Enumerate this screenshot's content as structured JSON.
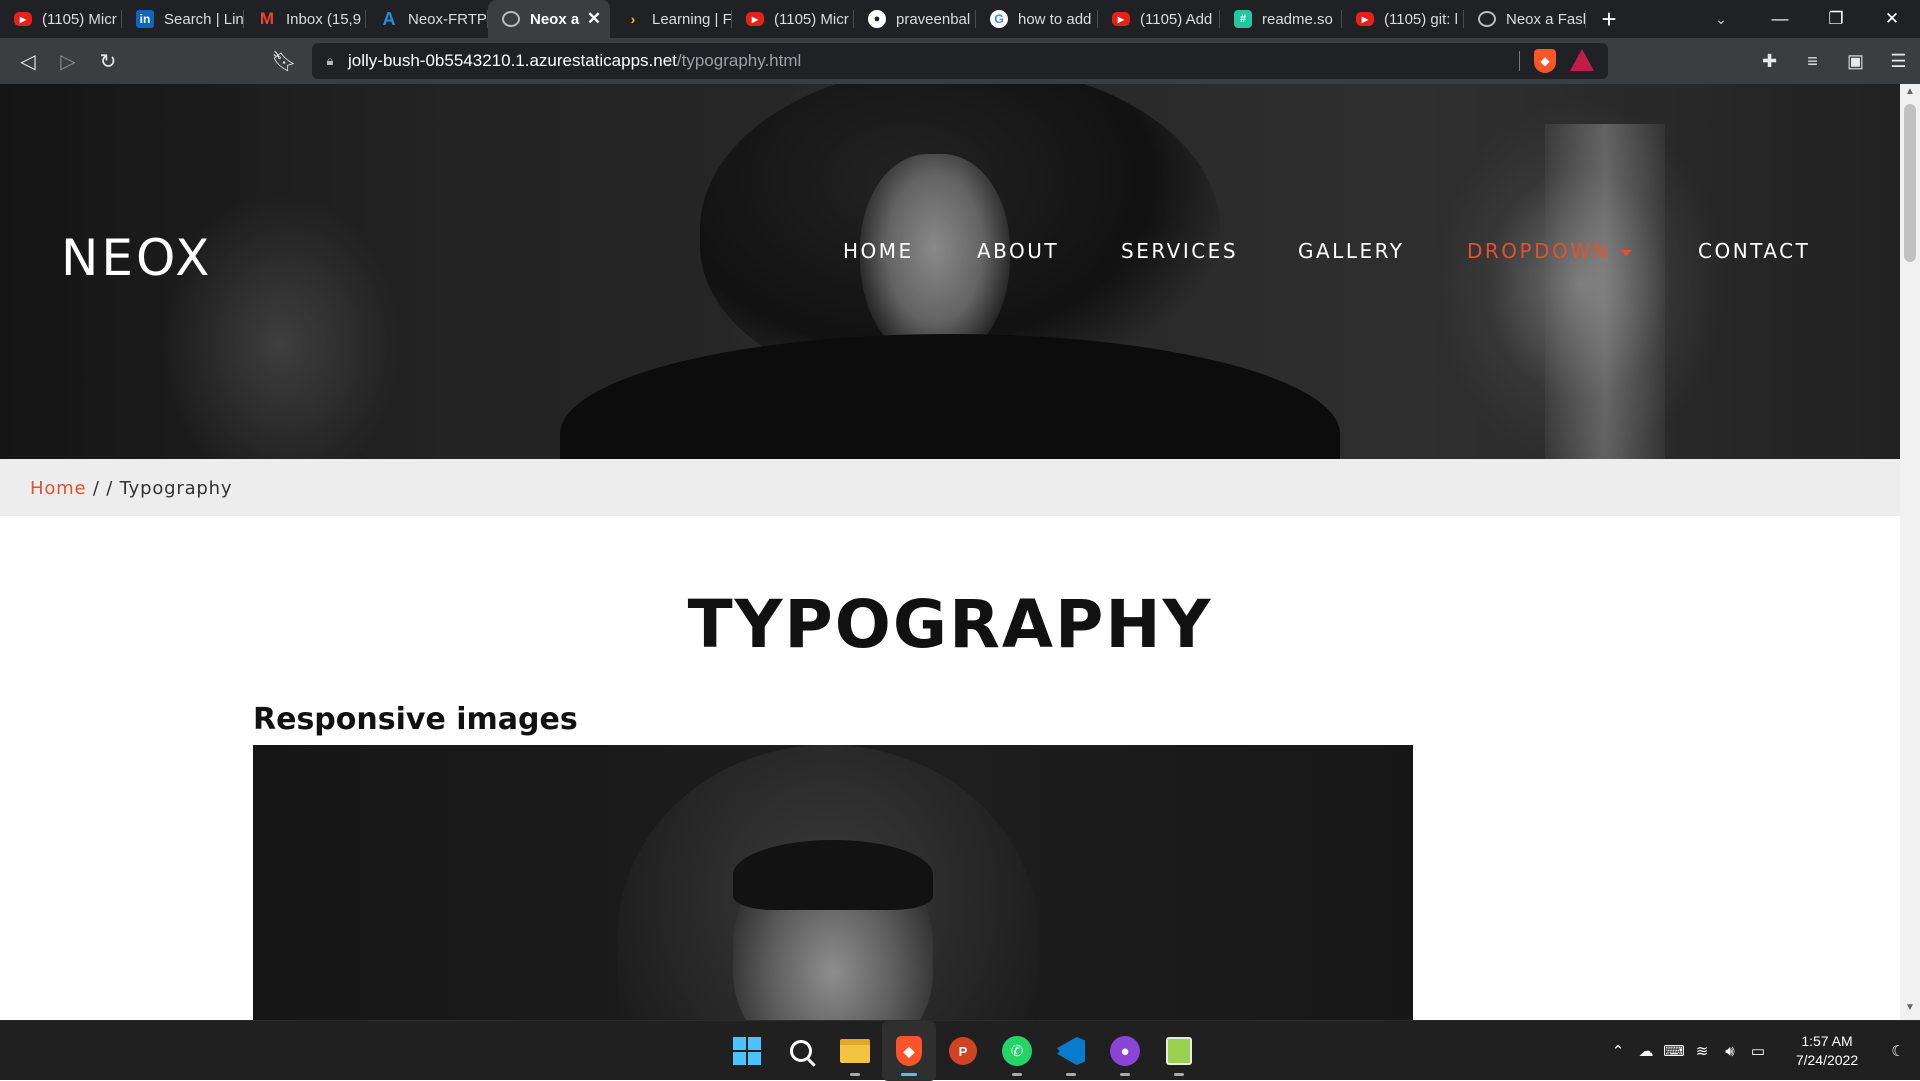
{
  "browser": {
    "tabs": [
      {
        "label": "(1105) Micr",
        "icon": "youtube-icon",
        "active": false
      },
      {
        "label": "Search | Lin",
        "icon": "linkedin-icon",
        "active": false
      },
      {
        "label": "Inbox (15,9",
        "icon": "gmail-icon",
        "active": false
      },
      {
        "label": "Neox-FRTP",
        "icon": "azure-icon",
        "active": false
      },
      {
        "label": "Neox a",
        "icon": "globe-icon",
        "active": true
      },
      {
        "label": "Learning | F",
        "icon": "learning-icon",
        "active": false
      },
      {
        "label": "(1105) Micr",
        "icon": "youtube-icon",
        "active": false
      },
      {
        "label": "praveenbal",
        "icon": "github-icon",
        "active": false
      },
      {
        "label": "how to add",
        "icon": "google-icon",
        "active": false
      },
      {
        "label": "(1105) Add",
        "icon": "youtube-icon",
        "active": false
      },
      {
        "label": "readme.so",
        "icon": "readme-icon",
        "active": false
      },
      {
        "label": "(1105) git: l",
        "icon": "youtube-icon",
        "active": false
      },
      {
        "label": "Neox a Fasl",
        "icon": "globe-icon",
        "active": false
      }
    ],
    "url_host": "jolly-bush-0b5543210.1.azurestaticapps.net",
    "url_path": "/typography.html"
  },
  "site": {
    "logo": "NEOX",
    "nav": [
      {
        "label": "HOME"
      },
      {
        "label": "ABOUT"
      },
      {
        "label": "SERVICES"
      },
      {
        "label": "GALLERY"
      },
      {
        "label": "DROPDOWN"
      },
      {
        "label": "CONTACT"
      }
    ],
    "active_color": "#e2522c",
    "breadcrumb": {
      "home": "Home",
      "separator": " / / ",
      "current": "Typography"
    },
    "page_title": "TYPOGRAPHY",
    "section_title": "Responsive images"
  },
  "taskbar": {
    "apps": [
      "windows-start-icon",
      "search-icon",
      "file-explorer-icon",
      "brave-browser-icon",
      "powerpoint-icon",
      "whatsapp-icon",
      "vscode-icon",
      "github-desktop-icon",
      "notepad-icon"
    ],
    "time": "1:57 AM",
    "date": "7/24/2022"
  }
}
